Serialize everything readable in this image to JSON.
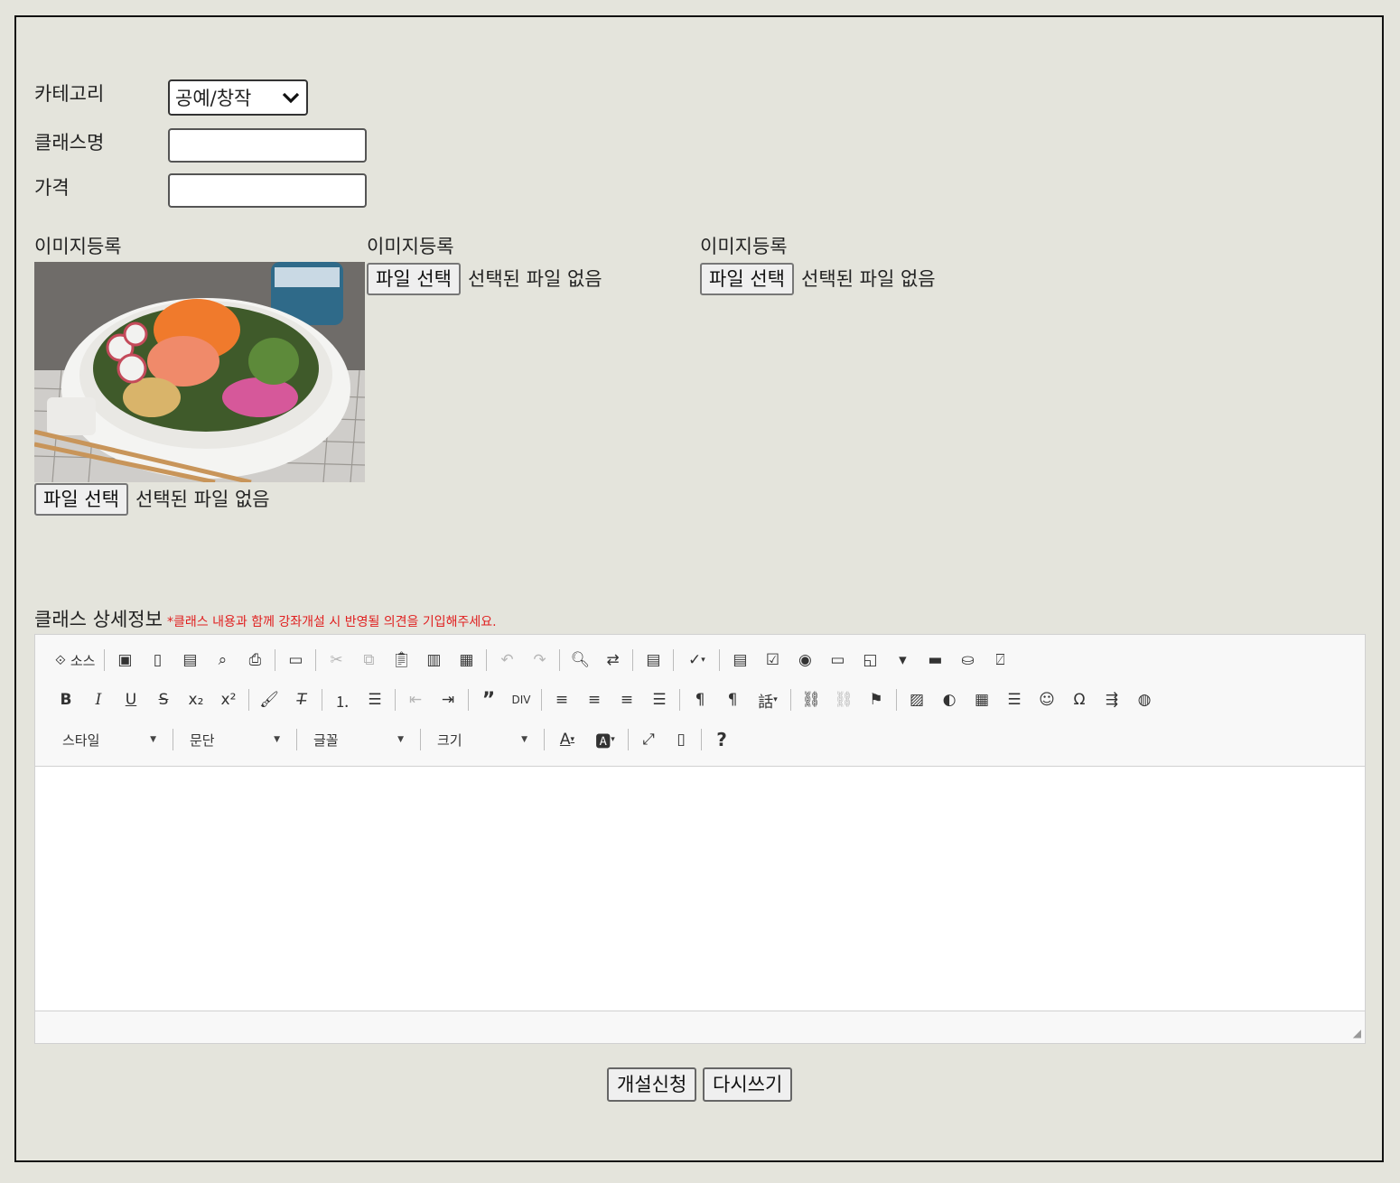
{
  "form": {
    "category_label": "카테고리",
    "category_value": "공예/창작",
    "class_name_label": "클래스명",
    "class_name_value": "",
    "price_label": "가격",
    "price_value": ""
  },
  "images": [
    {
      "label": "이미지등록",
      "button": "파일 선택",
      "status": "선택된 파일 없음"
    },
    {
      "label": "이미지등록",
      "button": "파일 선택",
      "status": "선택된 파일 없음"
    },
    {
      "label": "이미지등록",
      "button": "파일 선택",
      "status": "선택된 파일 없음"
    }
  ],
  "detail": {
    "label": "클래스 상세정보",
    "note": "*클래스 내용과 함께 강좌개설 시 반영될 의견을 기입해주세요."
  },
  "toolbar": {
    "source_label": "소스",
    "style_label": "스타일",
    "paragraph_label": "문단",
    "font_label": "글꼴",
    "size_label": "크기"
  },
  "actions": {
    "submit_label": "개설신청",
    "reset_label": "다시쓰기"
  },
  "colors": {
    "background": "#e4e4dc",
    "note_red": "#e02020"
  }
}
